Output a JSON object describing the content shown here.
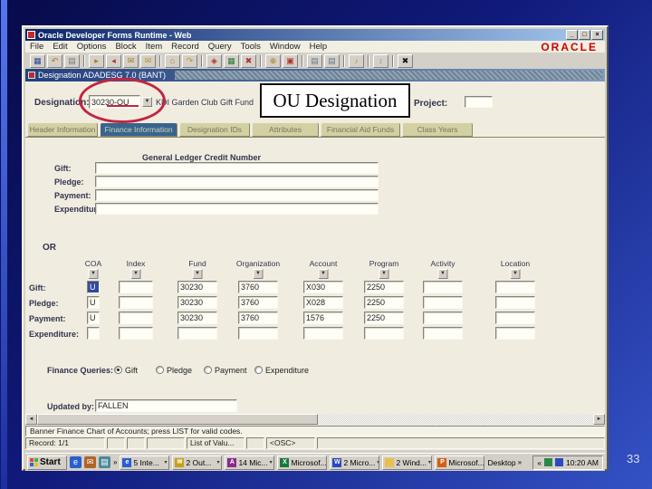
{
  "colors": {
    "accent_red": "#c22540",
    "oracle_brand": "#cc0000",
    "titlebar_blue": "#0a246a",
    "selected_tab_blue": "#38648e",
    "slide_background": "#101a7a",
    "canvas_beige": "#f0ede0"
  },
  "slide": {
    "page_number": "33"
  },
  "window": {
    "title": "Oracle Developer Forms Runtime - Web",
    "buttons": {
      "minimize": "_",
      "maximize": "□",
      "close": "×"
    },
    "menu": [
      "File",
      "Edit",
      "Options",
      "Block",
      "Item",
      "Record",
      "Query",
      "Tools",
      "Window",
      "Help"
    ],
    "brand": "ORACLE",
    "form_title": "Designation ADADESG 7.0 (BANT)"
  },
  "icons": {
    "dropdown": "▼",
    "scroll_left": "◄",
    "scroll_right": "►",
    "tray_collapse": "«",
    "group_arrow": "▾"
  },
  "toolbar": {
    "buttons": [
      {
        "name": "save",
        "glyph": "▦"
      },
      {
        "name": "rollback",
        "glyph": "↶"
      },
      {
        "name": "print",
        "glyph": "▤"
      },
      {
        "name": "insert-record",
        "glyph": "▸"
      },
      {
        "name": "remove-record",
        "glyph": "◂"
      },
      {
        "name": "enter-query",
        "glyph": "✉"
      },
      {
        "name": "execute-query",
        "glyph": "✉"
      },
      {
        "name": "previous-block",
        "glyph": "⌂"
      },
      {
        "name": "next-block",
        "glyph": "↷"
      },
      {
        "name": "cancel-query",
        "glyph": "◈"
      },
      {
        "name": "view-table",
        "glyph": "▦"
      },
      {
        "name": "remove-table",
        "glyph": "✖"
      },
      {
        "name": "post",
        "glyph": "⊕"
      },
      {
        "name": "user",
        "glyph": "▣"
      },
      {
        "name": "window-list-1",
        "glyph": "▤"
      },
      {
        "name": "window-list-2",
        "glyph": "▤"
      },
      {
        "name": "sound",
        "glyph": "♪"
      },
      {
        "name": "navigate",
        "glyph": "↕"
      },
      {
        "name": "exit",
        "glyph": "✖"
      }
    ]
  },
  "annotation": {
    "callout_text": "OU Designation"
  },
  "form": {
    "designation": {
      "label": "Designation:",
      "value": "30230-OU",
      "description": "KDI  Garden Club Gift Fund"
    },
    "project": {
      "label": "Project:",
      "value": ""
    },
    "tabs": [
      {
        "label": "Header Information",
        "selected": false
      },
      {
        "label": "Finance Information",
        "selected": true
      },
      {
        "label": "Designation IDs",
        "selected": false
      },
      {
        "label": "Attributes",
        "selected": false
      },
      {
        "label": "Financial Aid Funds",
        "selected": false
      },
      {
        "label": "Class Years",
        "selected": false
      }
    ],
    "gl_section": {
      "title": "General Ledger Credit Number",
      "rows": [
        {
          "label": "Gift:",
          "value": ""
        },
        {
          "label": "Pledge:",
          "value": ""
        },
        {
          "label": "Payment:",
          "value": ""
        },
        {
          "label": "Expenditure:",
          "value": ""
        }
      ]
    },
    "or_label": "OR",
    "grid": {
      "columns": [
        "COA",
        "Index",
        "Fund",
        "Organization",
        "Account",
        "Program",
        "Activity",
        "Location"
      ],
      "rows": [
        {
          "label": "Gift:",
          "values": [
            "U",
            "",
            "30230",
            "3760",
            "X030",
            "2250",
            "",
            ""
          ]
        },
        {
          "label": "Pledge:",
          "values": [
            "U",
            "",
            "30230",
            "3760",
            "X028",
            "2250",
            "",
            ""
          ]
        },
        {
          "label": "Payment:",
          "values": [
            "U",
            "",
            "30230",
            "3760",
            "1576",
            "2250",
            "",
            ""
          ]
        },
        {
          "label": "Expenditure:",
          "values": [
            "",
            "",
            "",
            "",
            "",
            "",
            "",
            ""
          ]
        }
      ]
    },
    "finance_queries": {
      "label": "Finance Queries:",
      "options": [
        {
          "label": "Gift",
          "selected": true
        },
        {
          "label": "Pledge",
          "selected": false
        },
        {
          "label": "Payment",
          "selected": false
        },
        {
          "label": "Expenditure",
          "selected": false
        }
      ]
    },
    "updated_by": {
      "label": "Updated by:",
      "value": "FALLEN"
    }
  },
  "statusbar": {
    "hint": "Banner Finance Chart of Accounts; press LIST for valid codes.",
    "record": "Record: 1/1",
    "lov": "List of Valu...",
    "mode": "<OSC>"
  },
  "taskbar": {
    "start_label": "Start",
    "quick_launch": [
      {
        "name": "internet-explorer",
        "glyph": "e"
      },
      {
        "name": "outlook",
        "glyph": "✉"
      },
      {
        "name": "show-desktop",
        "glyph": "▤"
      }
    ],
    "tasks": [
      {
        "label": "5 Inte...",
        "icon": "internet-explorer",
        "glyph": "e",
        "grouped": true
      },
      {
        "label": "2 Out...",
        "icon": "outlook",
        "glyph": "✉",
        "grouped": true
      },
      {
        "label": "14 Mic...",
        "icon": "access",
        "glyph": "A",
        "grouped": true
      },
      {
        "label": "Microsof...",
        "icon": "excel",
        "glyph": "X",
        "grouped": false
      },
      {
        "label": "2 Micro...",
        "icon": "word",
        "glyph": "W",
        "grouped": true
      },
      {
        "label": "2 Wind...",
        "icon": "folder",
        "glyph": "",
        "grouped": true
      },
      {
        "label": "Microsof...",
        "icon": "powerpoint",
        "glyph": "P",
        "grouped": false
      }
    ],
    "desktop_label": "Desktop",
    "overflow": "»",
    "tray_time": "10:20 AM"
  }
}
